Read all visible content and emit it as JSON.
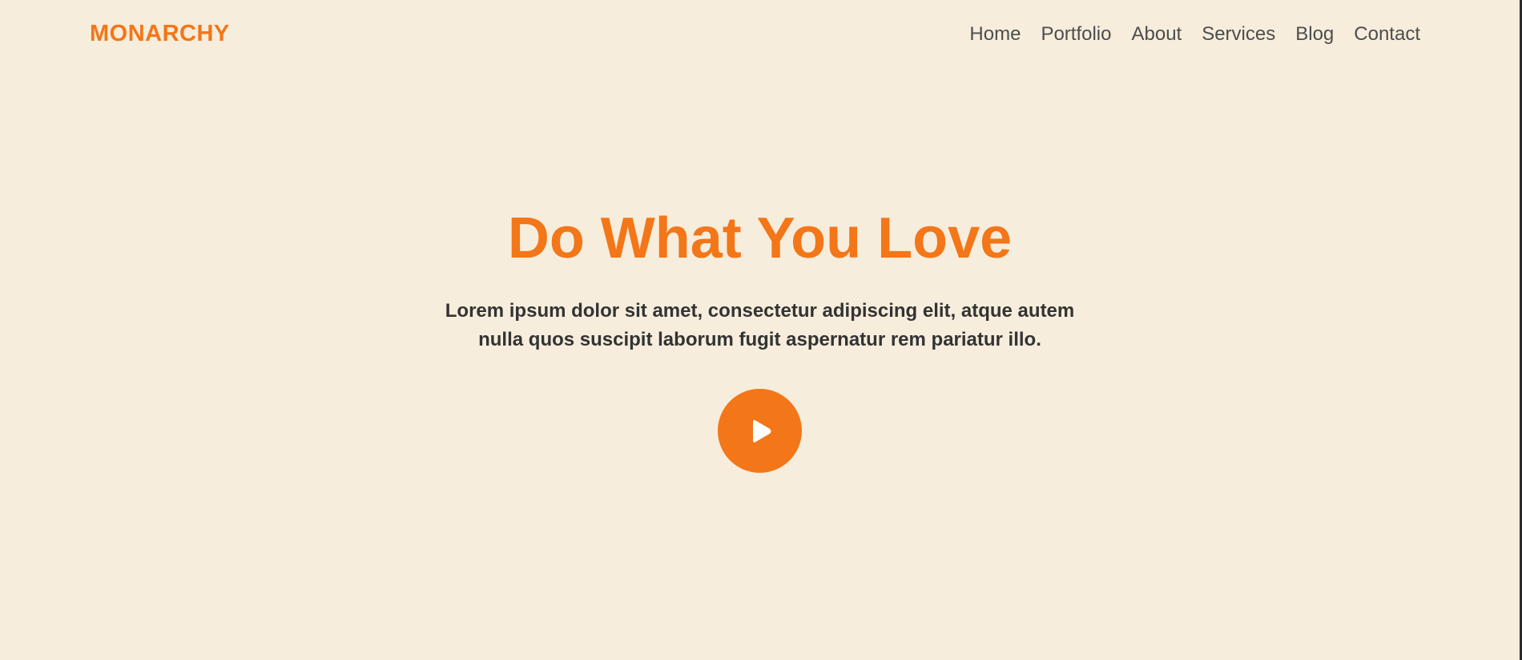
{
  "brand": {
    "name": "MONARCHY",
    "accent_color": "#f37618",
    "background_color": "#f7eddc"
  },
  "nav": {
    "items": [
      {
        "label": "Home"
      },
      {
        "label": "Portfolio"
      },
      {
        "label": "About"
      },
      {
        "label": "Services"
      },
      {
        "label": "Blog"
      },
      {
        "label": "Contact"
      }
    ]
  },
  "hero": {
    "title": "Do What You Love",
    "text": "Lorem ipsum dolor sit amet, consectetur adipiscing elit, atque autem nulla quos suscipit laborum fugit aspernatur rem pariatur illo.",
    "play_icon": "play-icon"
  }
}
